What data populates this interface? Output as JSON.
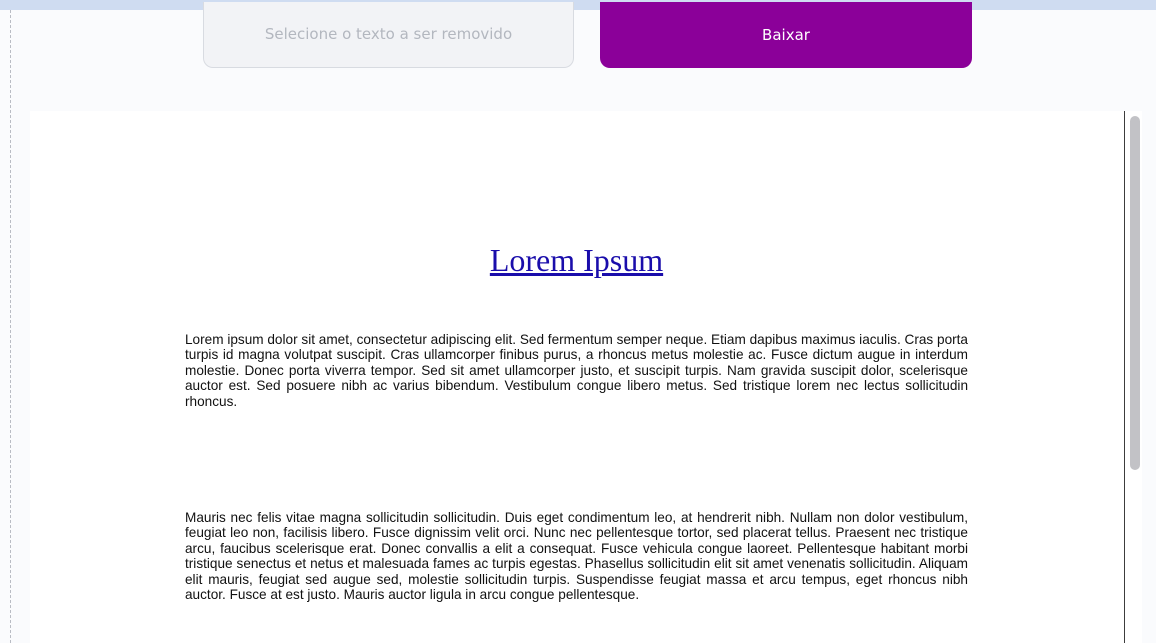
{
  "controls": {
    "select_placeholder": "Selecione o texto a ser removido",
    "download_label": "Baixar"
  },
  "colors": {
    "download_button": "#8b0099",
    "title_link": "#1a0dab",
    "top_strip": "#cfdcf1"
  },
  "document": {
    "title": "Lorem Ipsum",
    "paragraphs": [
      "Lorem ipsum dolor sit amet, consectetur adipiscing elit. Sed fermentum semper neque. Etiam dapibus maximus iaculis. Cras porta turpis id magna volutpat suscipit. Cras ullamcorper finibus purus, a rhoncus metus molestie ac. Fusce dictum augue in interdum molestie. Donec porta viverra tempor. Sed sit amet ullamcorper justo, et suscipit turpis. Nam gravida suscipit dolor, scelerisque auctor est. Sed posuere nibh ac varius bibendum. Vestibulum congue libero metus. Sed tristique lorem nec lectus sollicitudin rhoncus.",
      "Mauris nec felis vitae magna sollicitudin sollicitudin. Duis eget condimentum leo, at hendrerit nibh. Nullam non dolor vestibulum, feugiat leo non, facilisis libero. Fusce dignissim velit orci. Nunc nec pellentesque tortor, sed placerat tellus. Praesent nec tristique arcu, faucibus scelerisque erat. Donec convallis a elit a consequat. Fusce vehicula congue laoreet. Pellentesque habitant morbi tristique senectus et netus et malesuada fames ac turpis egestas. Phasellus sollicitudin elit sit amet venenatis sollicitudin. Aliquam elit mauris, feugiat sed augue sed, molestie sollicitudin turpis. Suspendisse feugiat massa et arcu tempus, eget rhoncus nibh auctor. Fusce at est justo. Mauris auctor ligula in arcu congue pellentesque."
    ]
  }
}
